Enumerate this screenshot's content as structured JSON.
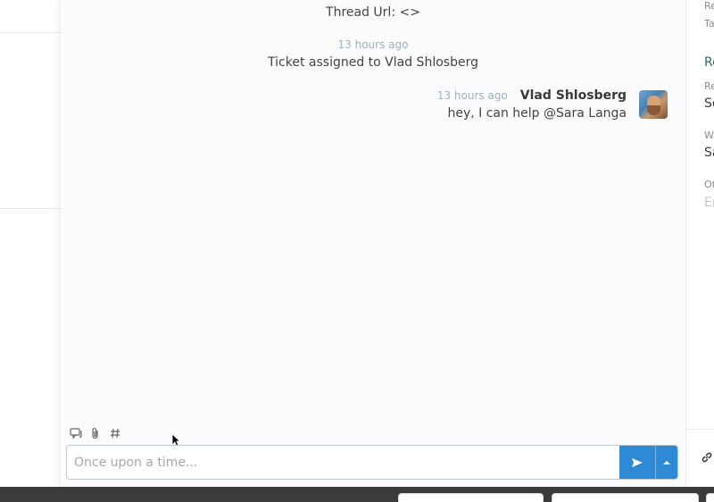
{
  "thread": {
    "url_line": "Thread Url: <>",
    "system_event": {
      "time": "13 hours ago",
      "text": "Ticket assigned to Vlad Shlosberg"
    },
    "message": {
      "time": "13 hours ago",
      "author": "Vlad Shlosberg",
      "text": "hey, I can help @Sara Langa"
    }
  },
  "composer": {
    "placeholder": "Once upon a time...",
    "value": "",
    "tools": [
      "comment-icon",
      "paperclip-icon",
      "hashtag-icon"
    ]
  },
  "right_panel": {
    "labels": [
      "Re",
      "Ta",
      "Re",
      "Re",
      "So",
      "W",
      "Sa",
      "Ot",
      "En"
    ]
  },
  "colors": {
    "accent": "#2f8ad6",
    "timestamp": "#9bb1bd",
    "heading": "#2b6e6e"
  }
}
